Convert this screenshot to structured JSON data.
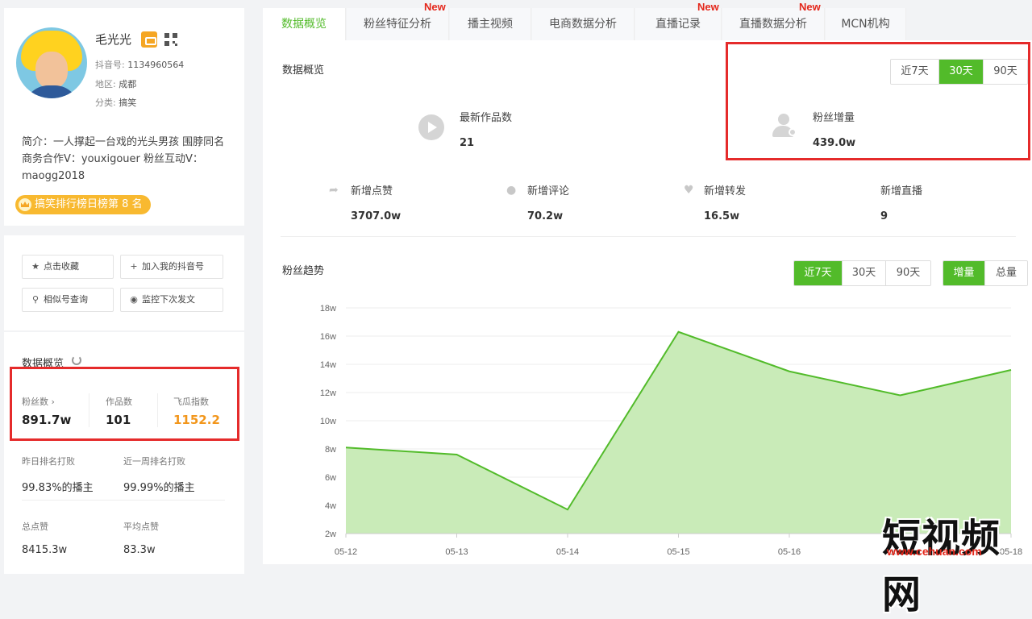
{
  "profile": {
    "name": "毛光光",
    "douyin_id_label": "抖音号:",
    "douyin_id": "1134960564",
    "region_label": "地区:",
    "region": "成都",
    "category_label": "分类:",
    "category": "搞笑",
    "bio": "简介：一人撑起一台戏的光头男孩 围脖同名 商务合作V：youxigouer 粉丝互动V：maogg2018",
    "rank_badge": "搞笑排行榜日榜第 8 名"
  },
  "actions": {
    "favorite": "点击收藏",
    "add_my": "加入我的抖音号",
    "similar": "相似号查询",
    "monitor": "监控下次发文"
  },
  "overview_left": {
    "title": "数据概览",
    "fans_label": "粉丝数",
    "fans_value": "891.7w",
    "works_label": "作品数",
    "works_value": "101",
    "index_label": "飞瓜指数",
    "index_value": "1152.2",
    "rank_yesterday_label": "昨日排名打败",
    "rank_yesterday_value": "99.83%的播主",
    "rank_week_label": "近一周排名打败",
    "rank_week_value": "99.99%的播主",
    "total_likes_label": "总点赞",
    "total_likes_value": "8415.3w",
    "avg_likes_label": "平均点赞",
    "avg_likes_value": "83.3w"
  },
  "tabs": [
    {
      "label": "数据概览",
      "new": ""
    },
    {
      "label": "粉丝特征分析",
      "new": "New"
    },
    {
      "label": "播主视频",
      "new": ""
    },
    {
      "label": "电商数据分析",
      "new": ""
    },
    {
      "label": "直播记录",
      "new": "New"
    },
    {
      "label": "直播数据分析",
      "new": "New"
    },
    {
      "label": "MCN机构",
      "new": ""
    }
  ],
  "overview": {
    "title": "数据概览",
    "range": [
      "近7天",
      "30天",
      "90天"
    ],
    "range_selected": "30天",
    "latest_works_label": "最新作品数",
    "latest_works_value": "21",
    "fan_growth_label": "粉丝增量",
    "fan_growth_value": "439.0w",
    "new_likes_label": "新增点赞",
    "new_likes_value": "3707.0w",
    "new_comments_label": "新增评论",
    "new_comments_value": "70.2w",
    "new_shares_label": "新增转发",
    "new_shares_value": "16.5w",
    "new_live_label": "新增直播",
    "new_live_value": "9"
  },
  "trend": {
    "title": "粉丝趋势",
    "range": [
      "近7天",
      "30天",
      "90天"
    ],
    "range_selected": "近7天",
    "mode": [
      "增量",
      "总量"
    ],
    "mode_selected": "增量"
  },
  "chart_data": {
    "type": "area",
    "x": [
      "05-12",
      "05-13",
      "05-14",
      "05-15",
      "05-16",
      "05-17",
      "05-18"
    ],
    "values": [
      8.1,
      7.6,
      3.7,
      16.3,
      13.5,
      11.8,
      13.6
    ],
    "ytick_labels": [
      "2w",
      "4w",
      "6w",
      "8w",
      "10w",
      "12w",
      "14w",
      "16w",
      "18w"
    ],
    "ylim": [
      2,
      18
    ],
    "color": "#52bb2a",
    "fill": "#c9ebb8"
  },
  "watermark": {
    "text": "短视频网",
    "url": "www.cehuan.com"
  },
  "colors": {
    "accent": "#52bb2a",
    "highlight_box": "#e52b2b",
    "new_tag": "#e4271b",
    "index_value": "#f2961b"
  }
}
